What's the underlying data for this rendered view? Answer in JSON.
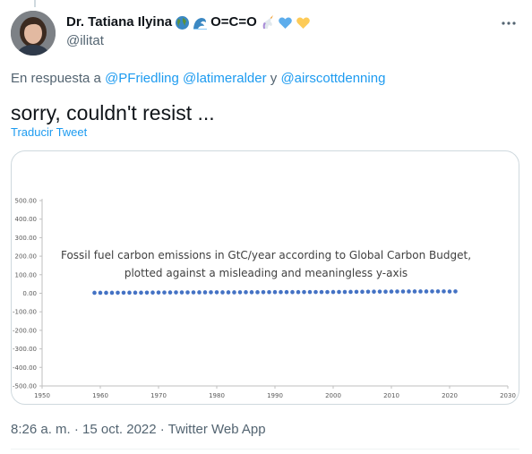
{
  "tweet": {
    "display_name": "Dr. Tatiana Ilyina",
    "name_suffix": "O=C=O",
    "handle": "@ilitat",
    "reply_prefix": "En respuesta a",
    "mentions": [
      "@PFriedling",
      "@latimeralder"
    ],
    "reply_connector": "y",
    "last_mention": "@airscottdenning",
    "text": "sorry, couldn't resist ...",
    "translate_label": "Traducir Tweet",
    "timestamp": "8:26 a. m. · 15 oct. 2022 · Twitter Web App",
    "more_icon": "more-horizontal-icon",
    "name_emojis": [
      "globe-icon",
      "wave-icon",
      "unicorn-icon",
      "blue-heart-icon",
      "yellow-heart-icon"
    ]
  },
  "chart_data": {
    "type": "scatter",
    "annotation": [
      "Fossil fuel carbon emissions in GtC/year according to Global Carbon Budget,",
      "plotted against a misleading and meaningless y-axis"
    ],
    "xlim": [
      1950,
      2030
    ],
    "ylim": [
      -500,
      500
    ],
    "x_ticks": [
      "1950",
      "1960",
      "1970",
      "1980",
      "1990",
      "2000",
      "2010",
      "2020",
      "2030"
    ],
    "y_ticks": [
      "500.00",
      "400.00",
      "300.00",
      "200.00",
      "100.00",
      "0.00",
      "-100.00",
      "-200.00",
      "-300.00",
      "-400.00",
      "-500.00"
    ],
    "marker_color": "#4472c4",
    "series": [
      {
        "x": [
          1959,
          1960,
          1961,
          1962,
          1963,
          1964,
          1965,
          1966,
          1967,
          1968,
          1969,
          1970,
          1971,
          1972,
          1973,
          1974,
          1975,
          1976,
          1977,
          1978,
          1979,
          1980,
          1981,
          1982,
          1983,
          1984,
          1985,
          1986,
          1987,
          1988,
          1989,
          1990,
          1991,
          1992,
          1993,
          1994,
          1995,
          1996,
          1997,
          1998,
          1999,
          2000,
          2001,
          2002,
          2003,
          2004,
          2005,
          2006,
          2007,
          2008,
          2009,
          2010,
          2011,
          2012,
          2013,
          2014,
          2015,
          2016,
          2017,
          2018,
          2019,
          2020,
          2021
        ],
        "y": [
          2.5,
          2.6,
          2.6,
          2.7,
          2.8,
          3.0,
          3.1,
          3.2,
          3.3,
          3.5,
          3.7,
          4.1,
          4.2,
          4.4,
          4.6,
          4.6,
          4.6,
          4.8,
          5.0,
          5.1,
          5.3,
          5.3,
          5.1,
          5.1,
          5.1,
          5.3,
          5.5,
          5.6,
          5.7,
          5.9,
          6.0,
          6.2,
          6.2,
          6.1,
          6.2,
          6.3,
          6.4,
          6.6,
          6.6,
          6.7,
          6.7,
          6.9,
          7.0,
          7.1,
          7.5,
          7.9,
          8.1,
          8.4,
          8.6,
          8.8,
          8.7,
          9.2,
          9.5,
          9.7,
          9.8,
          9.9,
          9.9,
          9.9,
          10.0,
          10.2,
          10.3,
          9.5,
          10.1
        ]
      }
    ]
  }
}
